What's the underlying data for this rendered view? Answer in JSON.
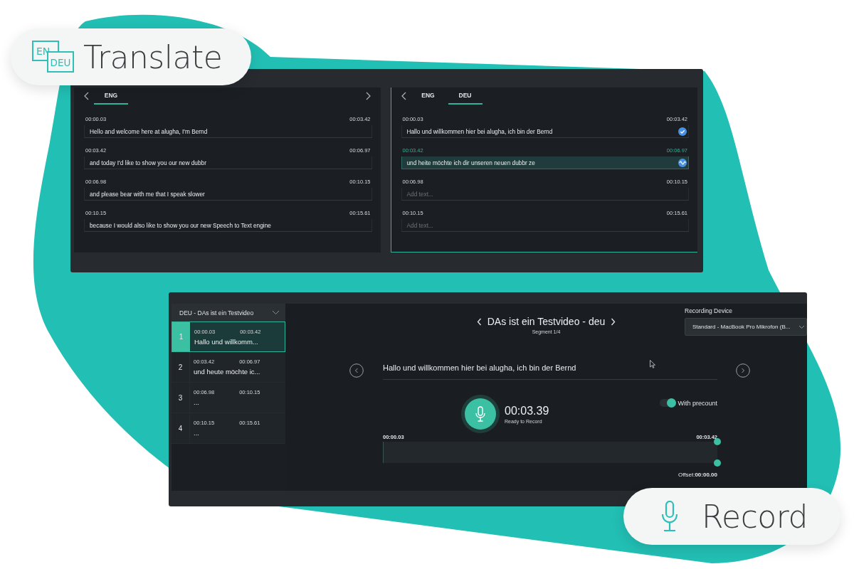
{
  "badges": [
    {
      "kind": "translate",
      "icon_texts": [
        "EN",
        "DEU"
      ],
      "label": "Translate"
    },
    {
      "kind": "record",
      "label": "Record"
    }
  ],
  "translate_window": {
    "panels": [
      {
        "has_next": true,
        "tabs": [
          {
            "label": "ENG",
            "selected": true
          }
        ],
        "segments": [
          {
            "start": "00:00.03",
            "end": "00:03.42",
            "text": "Hello and welcome here at alugha, I'm Bernd",
            "selected": false
          },
          {
            "start": "00:03.42",
            "end": "00:06.97",
            "text": "and today I'd like to show you our new dubbr",
            "selected": false
          },
          {
            "start": "00:06.98",
            "end": "00:10.15",
            "text": "and please bear with me that I speak slower",
            "selected": false
          },
          {
            "start": "00:10.15",
            "end": "00:15.61",
            "text": "because I would also like to show you our new Speech to Text engine",
            "selected": false
          }
        ]
      },
      {
        "has_next": false,
        "tabs": [
          {
            "label": "ENG",
            "selected": false
          },
          {
            "label": "DEU",
            "selected": true
          }
        ],
        "segments": [
          {
            "start": "00:00.03",
            "end": "00:03.42",
            "text": "Hallo und willkommen hier bei alugha, ich bin der Bernd",
            "kind": "done",
            "selected": false
          },
          {
            "start": "00:03.42",
            "end": "00:06.97",
            "text": "und heite möchte ich dir unseren neuen dubbr ze",
            "kind": "recording",
            "selected": true
          },
          {
            "start": "00:06.98",
            "end": "00:10.15",
            "placeholder": "Add text...",
            "selected": false
          },
          {
            "start": "00:10.15",
            "end": "00:15.61",
            "placeholder": "Add text...",
            "selected": false
          }
        ]
      }
    ]
  },
  "record_window": {
    "track_select": "DEU - DAs ist ein Testvideo",
    "segments": [
      {
        "number": "1",
        "start": "00:00.03",
        "end": "00:03.42",
        "text": "Hallo und willkomm...",
        "selected": true
      },
      {
        "number": "2",
        "start": "00:03.42",
        "end": "00:06.97",
        "text": "und heute möchte ic...",
        "selected": false
      },
      {
        "number": "3",
        "start": "00:06.98",
        "end": "00:10.15",
        "text": "...",
        "selected": false
      },
      {
        "number": "4",
        "start": "00:10.15",
        "end": "00:15.61",
        "text": "...",
        "selected": false
      }
    ],
    "title": "DAs ist ein Testvideo - deu",
    "subtitle": "Segment 1/4",
    "device_label": "Recording Device",
    "device": "Standard - MacBook Pro Mikrofon (B...",
    "segment_text": "Hallo und willkommen hier bei alugha, ich bin der Bernd",
    "precount": {
      "label": "With precount",
      "on": true
    },
    "time": "00:03.39",
    "status": "Ready to Record",
    "range_start": "00:00.03",
    "range_end": "00:03.42",
    "offset_label": "Offset:",
    "offset": "00:00.00"
  }
}
